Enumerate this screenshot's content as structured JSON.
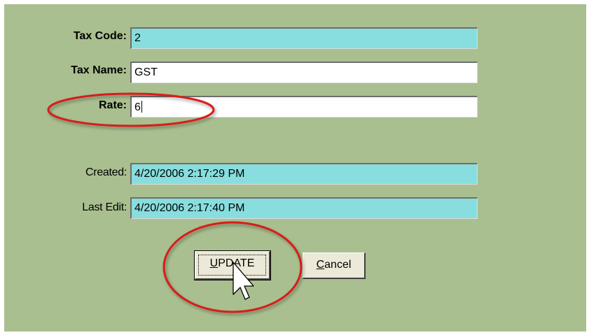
{
  "form": {
    "tax_code": {
      "label": "Tax Code:",
      "value": "2"
    },
    "tax_name": {
      "label": "Tax Name:",
      "value": "GST"
    },
    "rate": {
      "label": "Rate:",
      "value": "6"
    },
    "created": {
      "label": "Created:",
      "value": "4/20/2006 2:17:29 PM"
    },
    "last_edit": {
      "label": "Last Edit:",
      "value": "4/20/2006 2:17:40 PM"
    }
  },
  "buttons": {
    "update": {
      "mnemonic": "U",
      "rest": "PDATE"
    },
    "cancel": {
      "mnemonic": "C",
      "rest": "ancel"
    }
  },
  "colors": {
    "background": "#a9bf8f",
    "readonly_field": "#88dede",
    "editable_field": "#ffffff",
    "annotation": "#d81e1e"
  }
}
